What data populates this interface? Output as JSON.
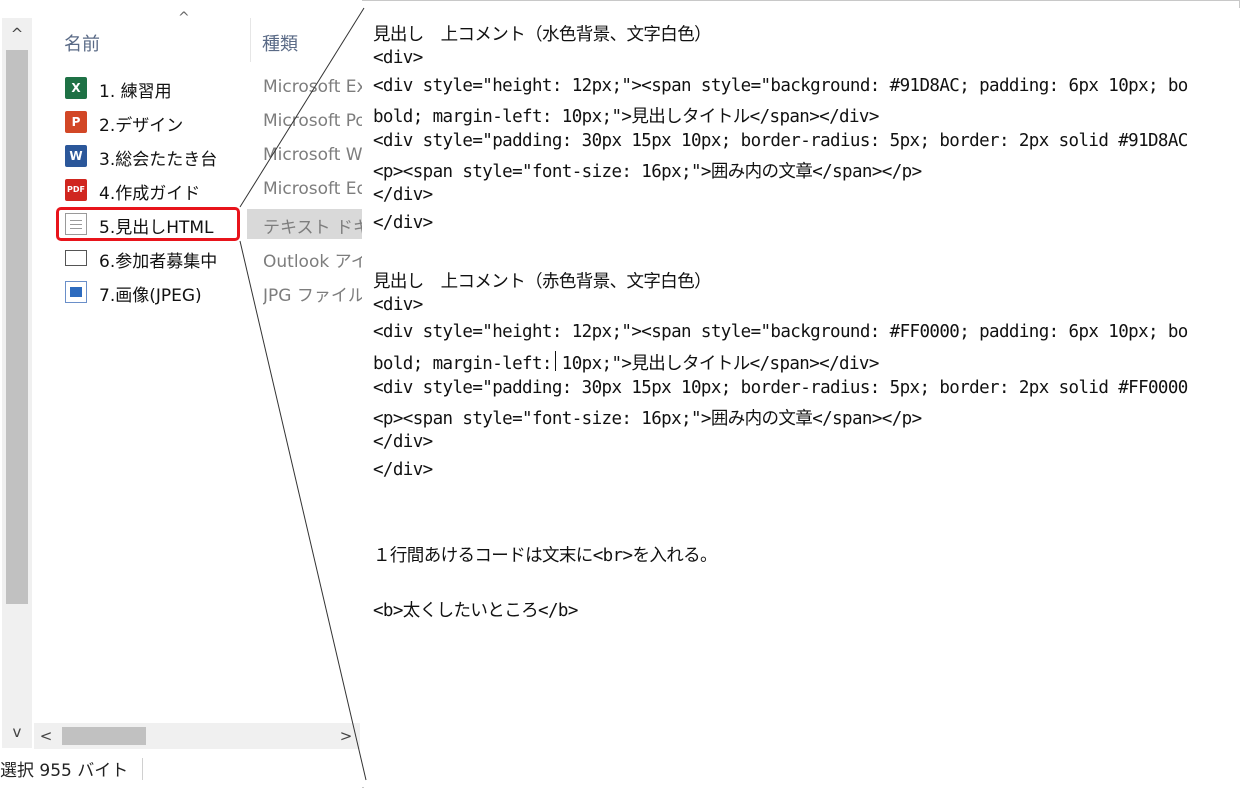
{
  "explorer": {
    "columns": {
      "name": "名前",
      "type": "種類"
    },
    "files": [
      {
        "name": "1. 練習用",
        "type": "Microsoft Ex",
        "icon": "excel-icon"
      },
      {
        "name": "2.デザイン",
        "type": "Microsoft Po",
        "icon": "powerpoint-icon"
      },
      {
        "name": "3.総会たたき台",
        "type": "Microsoft W",
        "icon": "word-icon"
      },
      {
        "name": "4.作成ガイド",
        "type": "Microsoft Ed",
        "icon": "pdf-icon"
      },
      {
        "name": "5.見出しHTML",
        "type": "テキスト ドキュ",
        "icon": "text-document-icon",
        "selected": true
      },
      {
        "name": "6.参加者募集中",
        "type": "Outlook アイ",
        "icon": "mail-icon"
      },
      {
        "name": "7.画像(JPEG)",
        "type": "JPG ファイル",
        "icon": "image-icon"
      }
    ],
    "status": "選択  955 バイト",
    "icons": {
      "excel": "X",
      "powerpoint": "P",
      "word": "W",
      "pdf": "PDF",
      "sort_up": "^",
      "scroll_up": "^",
      "scroll_down": "v",
      "scroll_left": "<",
      "scroll_right": ">"
    },
    "colors": {
      "highlight": "#e8141b",
      "selected_bg": "#d9d9d9"
    }
  },
  "editor": {
    "lines": [
      "見出し　上コメント（水色背景、文字白色）",
      "<div>",
      "<div style=\"height: 12px;\"><span style=\"background: #91D8AC; padding: 6px 10px; bo",
      "bold; margin-left: 10px;\">見出しタイトル</span></div>",
      "<div style=\"padding: 30px 15px 10px; border-radius: 5px; border: 2px solid #91D8AC",
      "<p><span style=\"font-size: 16px;\">囲み内の文章</span></p>",
      "</div>",
      "</div>",
      "",
      "見出し　上コメント（赤色背景、文字白色）",
      "<div>",
      "<div style=\"height: 12px;\"><span style=\"background: #FF0000; padding: 6px 10px; bo",
      "bold; margin-left: 10px;\">見出しタイトル</span></div>",
      "<div style=\"padding: 30px 15px 10px; border-radius: 5px; border: 2px solid #FF0000",
      "<p><span style=\"font-size: 16px;\">囲み内の文章</span></p>",
      "</div>",
      "</div>",
      "",
      "",
      "１行間あけるコードは文末に<br>を入れる。",
      "",
      "<b>太くしたいところ</b>"
    ]
  }
}
